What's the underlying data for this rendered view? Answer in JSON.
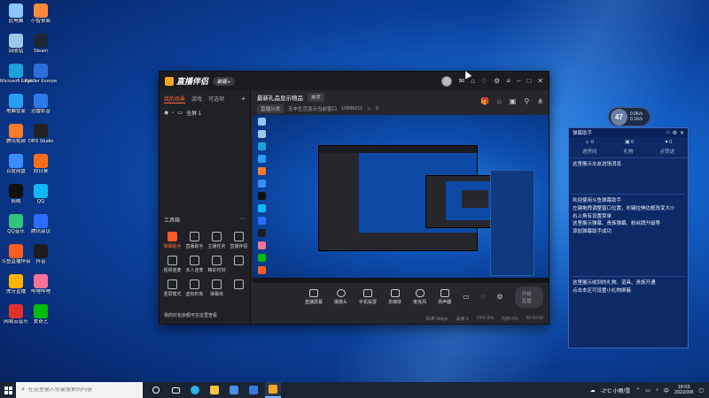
{
  "desktop": {
    "icons": [
      {
        "label": "此电脑",
        "color": "#8ec5ff"
      },
      {
        "label": "小智桌面",
        "color": "#ff8a3a"
      },
      {
        "label": "回收站",
        "color": "#9ec7e8"
      },
      {
        "label": "Steam",
        "color": "#1b2838"
      },
      {
        "label": "Microsoft Edge",
        "color": "#1fa0d8"
      },
      {
        "label": "Fiddler Everywhere",
        "color": "#2a6fdb"
      },
      {
        "label": "电脑管家",
        "color": "#2a9df4"
      },
      {
        "label": "迅雷影音",
        "color": "#2d7bea"
      },
      {
        "label": "腾讯视频",
        "color": "#ff7a2a"
      },
      {
        "label": "OBS Studio",
        "color": "#222222"
      },
      {
        "label": "百度网盘",
        "color": "#3a8cff"
      },
      {
        "label": "向日葵",
        "color": "#ff6d1a"
      },
      {
        "label": "剪映",
        "color": "#111111"
      },
      {
        "label": "QQ",
        "color": "#12b7f5"
      },
      {
        "label": "QQ音乐",
        "color": "#31c27c"
      },
      {
        "label": "腾讯会议",
        "color": "#2b6eff"
      },
      {
        "label": "斗鱼直播伴侣",
        "color": "#ff5d23"
      },
      {
        "label": "抖音",
        "color": "#1c1c1c"
      },
      {
        "label": "虎牙直播",
        "color": "#ffb400"
      },
      {
        "label": "哔哩哔哩",
        "color": "#fb7299"
      },
      {
        "label": "网易云音乐",
        "color": "#e0312b"
      },
      {
        "label": "爱奇艺",
        "color": "#00be06"
      }
    ]
  },
  "window": {
    "app_name": "直播伴侣",
    "version_badge": "新版 ▸",
    "scene_tabs": [
      "我的场景",
      "游戏",
      "可选项"
    ],
    "source_row": "全屏 1",
    "tools_title": "工具箱",
    "tools": [
      {
        "label": "弹幕助手",
        "hot": true
      },
      {
        "label": "直播助手",
        "hot": false
      },
      {
        "label": "主播任务",
        "hot": false
      },
      {
        "label": "直播伴侣",
        "hot": false
      },
      {
        "label": "视频连麦",
        "hot": false
      },
      {
        "label": "多人连麦",
        "hot": false
      },
      {
        "label": "精彩时刻",
        "hot": false
      },
      {
        "label": "",
        "hot": false
      },
      {
        "label": "竖屏模式",
        "hot": false
      },
      {
        "label": "虚拟形象",
        "hot": false
      },
      {
        "label": "弹幕库",
        "hot": false
      },
      {
        "label": "",
        "hot": false
      }
    ],
    "left_footer": "我的红包余额可在这里查看",
    "room_title": "最新礼品显示物品",
    "room_tag": "推荐",
    "room_category": "直播分类",
    "room_desc": "无中生活显示当前窗口",
    "room_id": "10996211",
    "room_fans": "0",
    "controls": [
      "直播屏幕",
      "摄像头",
      "手机投屏",
      "多媒体",
      "麦克风",
      "扬声器"
    ],
    "start_live": "开始直播",
    "status": [
      "码率 0kbps",
      "丢帧 0",
      "CPU 0%",
      "内存 0%",
      "00:00:00"
    ]
  },
  "danmaku": {
    "title": "弹幕助手",
    "stats": [
      "0",
      "0",
      "0"
    ],
    "cats": [
      "进房间",
      "礼物",
      "点赞送"
    ],
    "msg1": "这里展示水友进场消息",
    "msg2_lines": [
      "欢迎使用斗鱼弹幕助手",
      "左键拖拽调整窗口位置，右键拉伸边框改变大小",
      "右上角有设置菜单",
      "这里展示弹幕、贵族弹幕、粉丝牌升级等",
      "添加弹幕助手成功"
    ],
    "msg3_lines": [
      "这里展示收到的礼物、道具、贵族开通",
      "点击本区可设置小礼物屏蔽"
    ]
  },
  "net_widget": {
    "value": "47",
    "unit": "x",
    "up": "0.0K/s",
    "down": "0.1K/s"
  },
  "taskbar": {
    "search_placeholder": "在这里输入你要搜索的内容",
    "weather": "-2°C 小雨/雪",
    "lang": "中",
    "time": "18:03",
    "date": "2022/3/8"
  }
}
